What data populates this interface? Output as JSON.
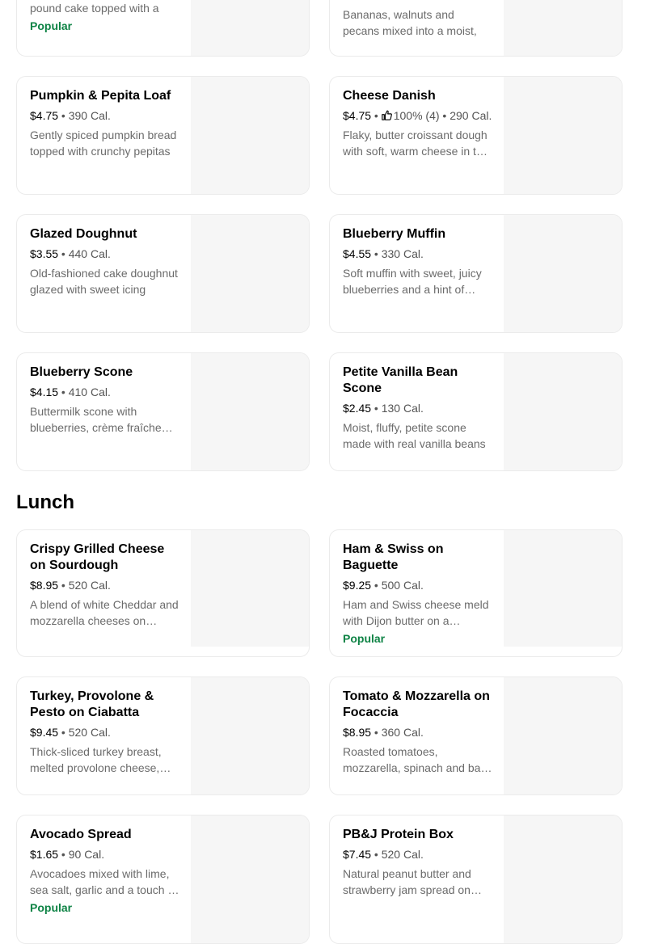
{
  "top_row": {
    "left_desc": "Citrusy, buttery, moist lemon pound cake topped with a",
    "left_badge": "Popular",
    "right_desc": "Bananas, walnuts and pecans mixed into a moist,"
  },
  "bakery_items": [
    {
      "name": "Pumpkin & Pepita Loaf",
      "price": "$4.75",
      "calories": "390 Cal.",
      "desc": "Gently spiced pumpkin bread topped with crunchy pepitas"
    },
    {
      "name": "Cheese Danish",
      "price": "$4.75",
      "rating": "100% (4)",
      "calories": "290 Cal.",
      "desc": "Flaky, butter croissant dough with soft, warm cheese in the center"
    },
    {
      "name": "Glazed Doughnut",
      "price": "$3.55",
      "calories": "440 Cal.",
      "desc": "Old-fashioned cake doughnut glazed with sweet icing"
    },
    {
      "name": "Blueberry Muffin",
      "price": "$4.55",
      "calories": "330 Cal.",
      "desc": "Soft muffin with sweet, juicy blueberries and a hint of lemon"
    },
    {
      "name": "Blueberry Scone",
      "price": "$4.15",
      "calories": "410 Cal.",
      "desc": "Buttermilk scone with blueberries, crème fraîche and icing"
    },
    {
      "name": "Petite Vanilla Bean Scone",
      "price": "$2.45",
      "calories": "130 Cal.",
      "desc": "Moist, fluffy, petite scone made with real vanilla beans"
    }
  ],
  "lunch_section": {
    "title": "Lunch"
  },
  "lunch_items": [
    {
      "name": "Crispy Grilled Cheese on Sourdough",
      "price": "$8.95",
      "calories": "520 Cal.",
      "desc": "A blend of white Cheddar and mozzarella cheeses on sourdough"
    },
    {
      "name": "Ham & Swiss on Baguette",
      "price": "$9.25",
      "calories": "500 Cal.",
      "desc": "Ham and Swiss cheese meld with Dijon butter on a baguette",
      "badge": "Popular"
    },
    {
      "name": "Turkey, Provolone & Pesto on Ciabatta",
      "price": "$9.45",
      "calories": "520 Cal.",
      "desc": "Thick-sliced turkey breast, melted provolone cheese, basil pesto"
    },
    {
      "name": "Tomato & Mozzarella on Focaccia",
      "price": "$8.95",
      "calories": "360 Cal.",
      "desc": "Roasted tomatoes, mozzarella, spinach and basil pesto"
    },
    {
      "name": "Avocado Spread",
      "price": "$1.65",
      "calories": "90 Cal.",
      "desc": "Avocadoes mixed with lime, sea salt, garlic and a touch of spice",
      "badge": "Popular"
    },
    {
      "name": "PB&J Protein Box",
      "price": "$7.45",
      "calories": "520 Cal.",
      "desc": "Natural peanut butter and strawberry jam spread on multigrain bread"
    }
  ],
  "colors": {
    "popular": "#0e8345",
    "image_placeholder": "#f6f6f6",
    "card_border": "#ebebeb"
  },
  "icons": {
    "rating": "thumbs-up-icon"
  }
}
